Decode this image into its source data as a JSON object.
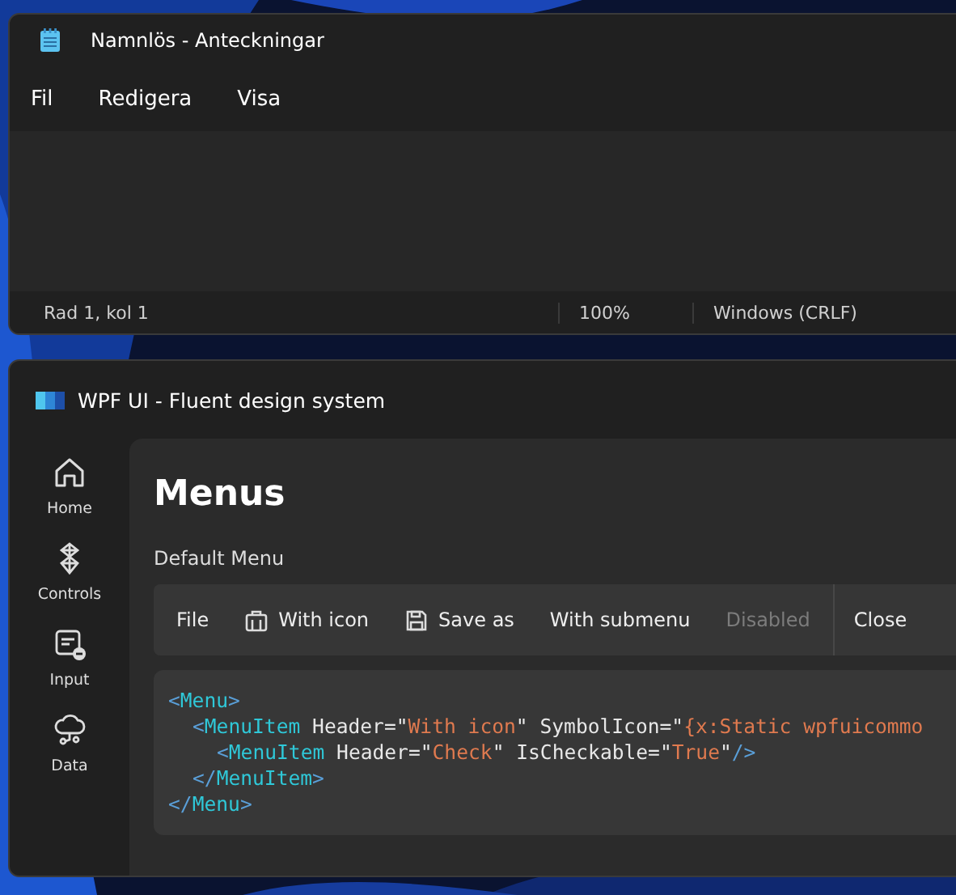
{
  "notepad": {
    "title": "Namnlös - Anteckningar",
    "menu": [
      "Fil",
      "Redigera",
      "Visa"
    ],
    "status_bar": [
      "Rad 1, kol 1",
      "100%",
      "Windows (CRLF)"
    ]
  },
  "wpf_window": {
    "title": "WPF UI - Fluent design system",
    "nav": [
      {
        "label": "Home"
      },
      {
        "label": "Controls"
      },
      {
        "label": "Input"
      },
      {
        "label": "Data"
      }
    ],
    "page_title": "Menus",
    "section_title": "Default Menu",
    "menu_items": [
      {
        "label": "File",
        "icon": false,
        "disabled": false,
        "separator_before": false
      },
      {
        "label": "With icon",
        "icon": true,
        "disabled": false,
        "separator_before": false
      },
      {
        "label": "Save as",
        "icon": true,
        "disabled": false,
        "separator_before": false
      },
      {
        "label": "With submenu",
        "icon": false,
        "disabled": false,
        "separator_before": false
      },
      {
        "label": "Disabled",
        "icon": false,
        "disabled": true,
        "separator_before": false
      },
      {
        "label": "Close",
        "icon": false,
        "disabled": false,
        "separator_before": true
      }
    ],
    "code": [
      {
        "tokens": [
          {
            "kind": "bracket",
            "text": "<"
          },
          {
            "kind": "tag",
            "text": "Menu"
          },
          {
            "kind": "bracket",
            "text": ">"
          }
        ],
        "children": [
          {
            "tokens": [
              {
                "kind": "bracket",
                "text": "<"
              },
              {
                "kind": "tag",
                "text": "MenuItem"
              },
              {
                "kind": "attr",
                "text": " Header="
              },
              {
                "kind": "quote",
                "text": "\""
              },
              {
                "kind": "string",
                "text": "With icon"
              },
              {
                "kind": "quote",
                "text": "\""
              },
              {
                "kind": "attr",
                "text": " SymbolIcon="
              },
              {
                "kind": "quote",
                "text": "\""
              },
              {
                "kind": "string",
                "text": "{x:Static wpfuicommo"
              }
            ],
            "children": [
              {
                "tokens": [
                  {
                    "kind": "bracket",
                    "text": "<"
                  },
                  {
                    "kind": "tag",
                    "text": "MenuItem"
                  },
                  {
                    "kind": "attr",
                    "text": " Header="
                  },
                  {
                    "kind": "quote",
                    "text": "\""
                  },
                  {
                    "kind": "string",
                    "text": "Check"
                  },
                  {
                    "kind": "quote",
                    "text": "\""
                  },
                  {
                    "kind": "attr",
                    "text": " IsCheckable="
                  },
                  {
                    "kind": "quote",
                    "text": "\""
                  },
                  {
                    "kind": "string",
                    "text": "True"
                  },
                  {
                    "kind": "quote",
                    "text": "\""
                  },
                  {
                    "kind": "bracket",
                    "text": "/>"
                  }
                ]
              }
            ]
          },
          {
            "tokens": [
              {
                "kind": "bracket",
                "text": "</"
              },
              {
                "kind": "tag",
                "text": "MenuItem"
              },
              {
                "kind": "bracket",
                "text": ">"
              }
            ]
          }
        ]
      },
      {
        "tokens": [
          {
            "kind": "bracket",
            "text": "</"
          },
          {
            "kind": "tag",
            "text": "Menu"
          },
          {
            "kind": "bracket",
            "text": ">"
          }
        ]
      }
    ]
  }
}
